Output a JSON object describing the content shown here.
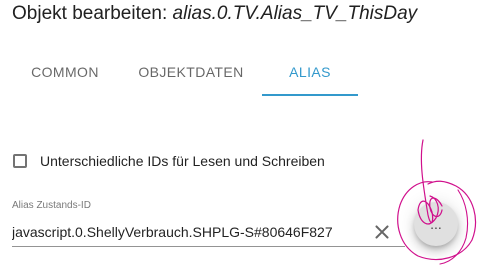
{
  "dialog": {
    "title_prefix": "Objekt bearbeiten: ",
    "object_id": "alias.0.TV.Alias_TV_ThisDay"
  },
  "tabs": [
    {
      "label": "COMMON",
      "active": false
    },
    {
      "label": "OBJEKTDATEN",
      "active": false
    },
    {
      "label": "ALIAS",
      "active": true
    }
  ],
  "alias": {
    "different_ids_label": "Unterschiedliche IDs für Lesen und Schreiben",
    "different_ids_checked": false,
    "state_id_label": "Alias Zustands-ID",
    "state_id_value": "javascript.0.ShellyVerbrauch.SHPLG-S#80646F827",
    "select_button_label": "..."
  },
  "colors": {
    "accent": "#3399cc",
    "annotation": "#d0108c"
  },
  "icons": {
    "clear": "close-icon"
  }
}
